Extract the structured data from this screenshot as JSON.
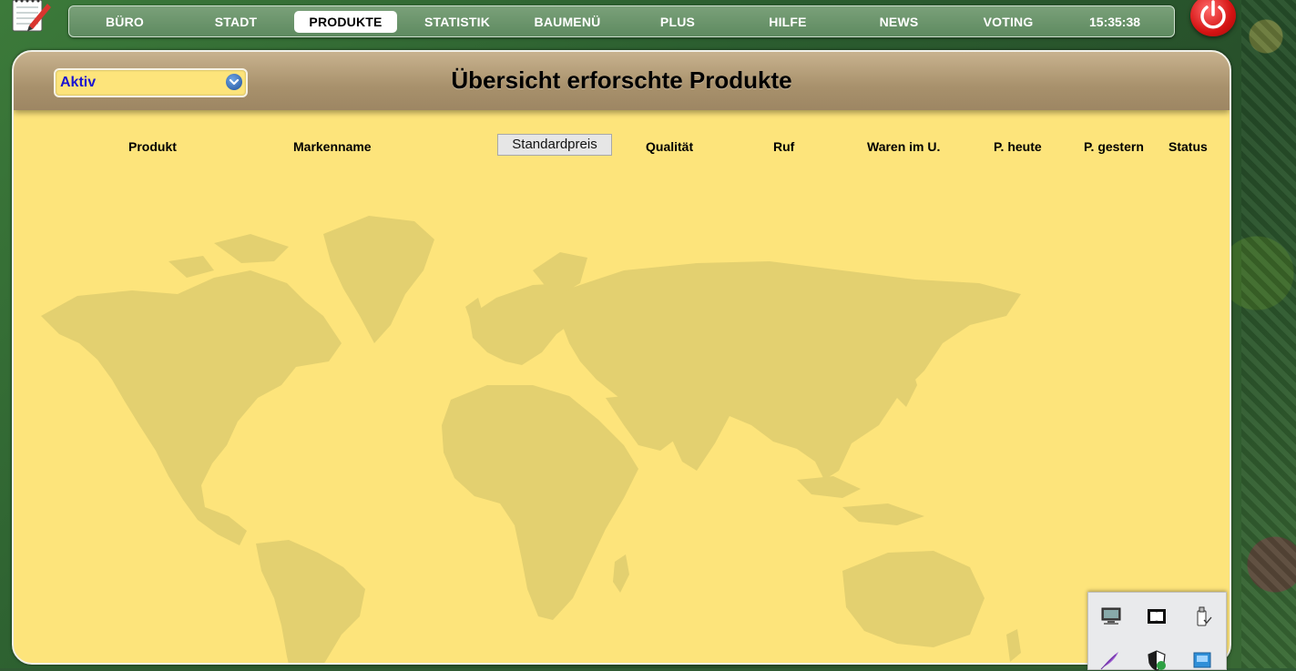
{
  "nav": {
    "items": [
      {
        "label": "BÜRO"
      },
      {
        "label": "STADT"
      },
      {
        "label": "PRODUKTE"
      },
      {
        "label": "STATISTIK"
      },
      {
        "label": "BAUMENÜ"
      },
      {
        "label": "PLUS"
      },
      {
        "label": "HILFE"
      },
      {
        "label": "NEWS"
      },
      {
        "label": "VOTING"
      }
    ],
    "active": "PRODUKTE",
    "clock": "15:35:38"
  },
  "panel": {
    "title": "Übersicht erforschte Produkte",
    "filter": {
      "selected": "Aktiv"
    },
    "columns": {
      "product": "Produkt",
      "brand": "Markenname",
      "standard_price": "Standardpreis",
      "quality": "Qualität",
      "reputation": "Ruf",
      "stock": "Waren im U.",
      "price_today": "P. heute",
      "price_yesterday": "P. gestern",
      "status": "Status"
    }
  },
  "tray": {
    "icons": [
      "monitor-icon",
      "dolby-icon",
      "usb-drive-icon",
      "feather-icon",
      "shield-icon",
      "network-icon"
    ]
  },
  "colors": {
    "panel_bg": "#fde47b",
    "header_bg": "#a8916c",
    "nav_bg": "#6b956c",
    "filter_text": "#1a14d0",
    "power": "#d51313"
  }
}
